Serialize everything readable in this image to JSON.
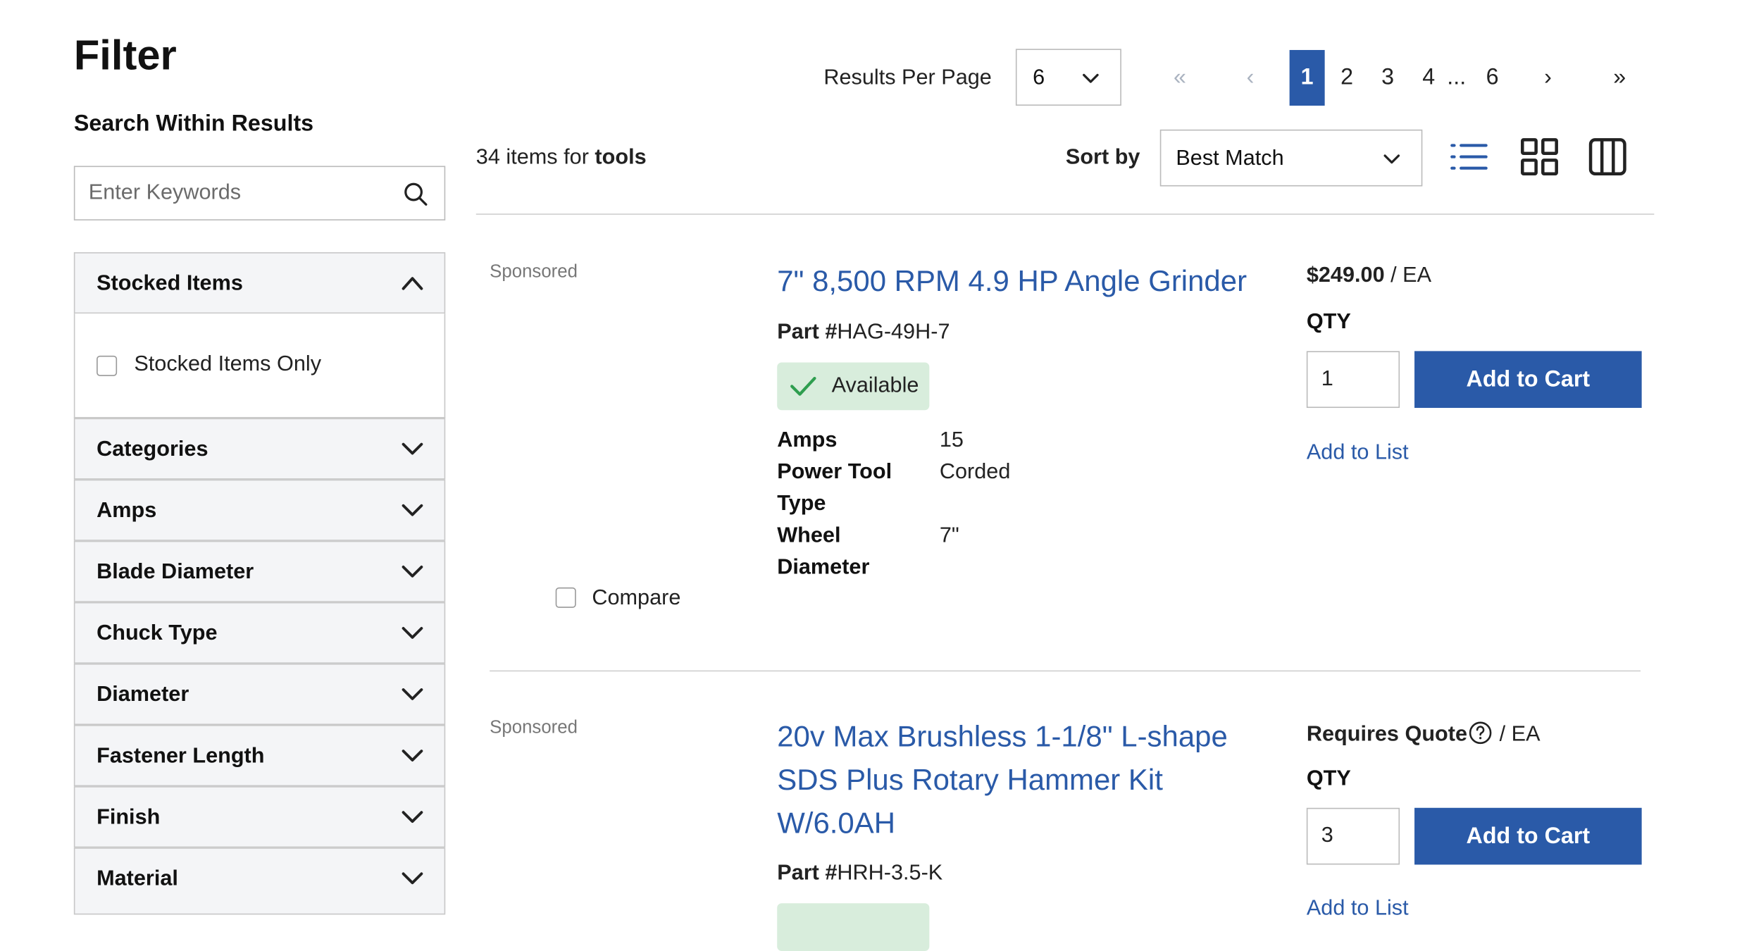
{
  "sidebar": {
    "title": "Filter",
    "search_label": "Search Within Results",
    "search_placeholder": "Enter Keywords",
    "stocked": {
      "label": "Stocked Items",
      "option": "Stocked Items Only"
    },
    "facets": [
      "Categories",
      "Amps",
      "Blade Diameter",
      "Chuck Type",
      "Diameter",
      "Fastener Length",
      "Finish",
      "Material"
    ]
  },
  "toolbar": {
    "results_per_page_label": "Results Per Page",
    "results_per_page_value": "6",
    "pagination": {
      "first": "«",
      "prev": "‹",
      "pages": [
        "1",
        "2",
        "3",
        "4"
      ],
      "ellipsis": "...",
      "last_page": "6",
      "next": "›",
      "last": "»",
      "current": "1"
    },
    "results_count_prefix": "34 items for",
    "results_query": "tools",
    "sort_label": "Sort by",
    "sort_value": "Best Match",
    "view_modes": [
      "list-view-icon",
      "grid-view-icon",
      "column-view-icon"
    ]
  },
  "products": [
    {
      "sponsored": "Sponsored",
      "title": "7\" 8,500 RPM 4.9 HP Angle Grinder",
      "part_label": "Part #",
      "part_number": "HAG-49H-7",
      "availability": "Available",
      "specs": [
        {
          "key": "Amps",
          "value": "15"
        },
        {
          "key": "Power Tool Type",
          "value": "Corded"
        },
        {
          "key": "Wheel Diameter",
          "value": "7\""
        }
      ],
      "price": "$249.00",
      "unit": "/ EA",
      "qty_label": "QTY",
      "qty": "1",
      "add_to_cart": "Add to Cart",
      "add_to_list": "Add to List",
      "compare": "Compare"
    },
    {
      "sponsored": "Sponsored",
      "title": "20v Max Brushless 1-1/8\" L-shape SDS Plus Rotary Hammer Kit W/6.0AH",
      "part_label": "Part #",
      "part_number": "HRH-3.5-K",
      "price": "Requires Quote",
      "unit": "/ EA",
      "qty_label": "QTY",
      "qty": "3",
      "add_to_cart": "Add to Cart",
      "add_to_list": "Add to List"
    }
  ],
  "colors": {
    "brand_blue": "#2a5aa8",
    "available_bg": "#d8eddc",
    "available_check": "#2e9e4f"
  }
}
